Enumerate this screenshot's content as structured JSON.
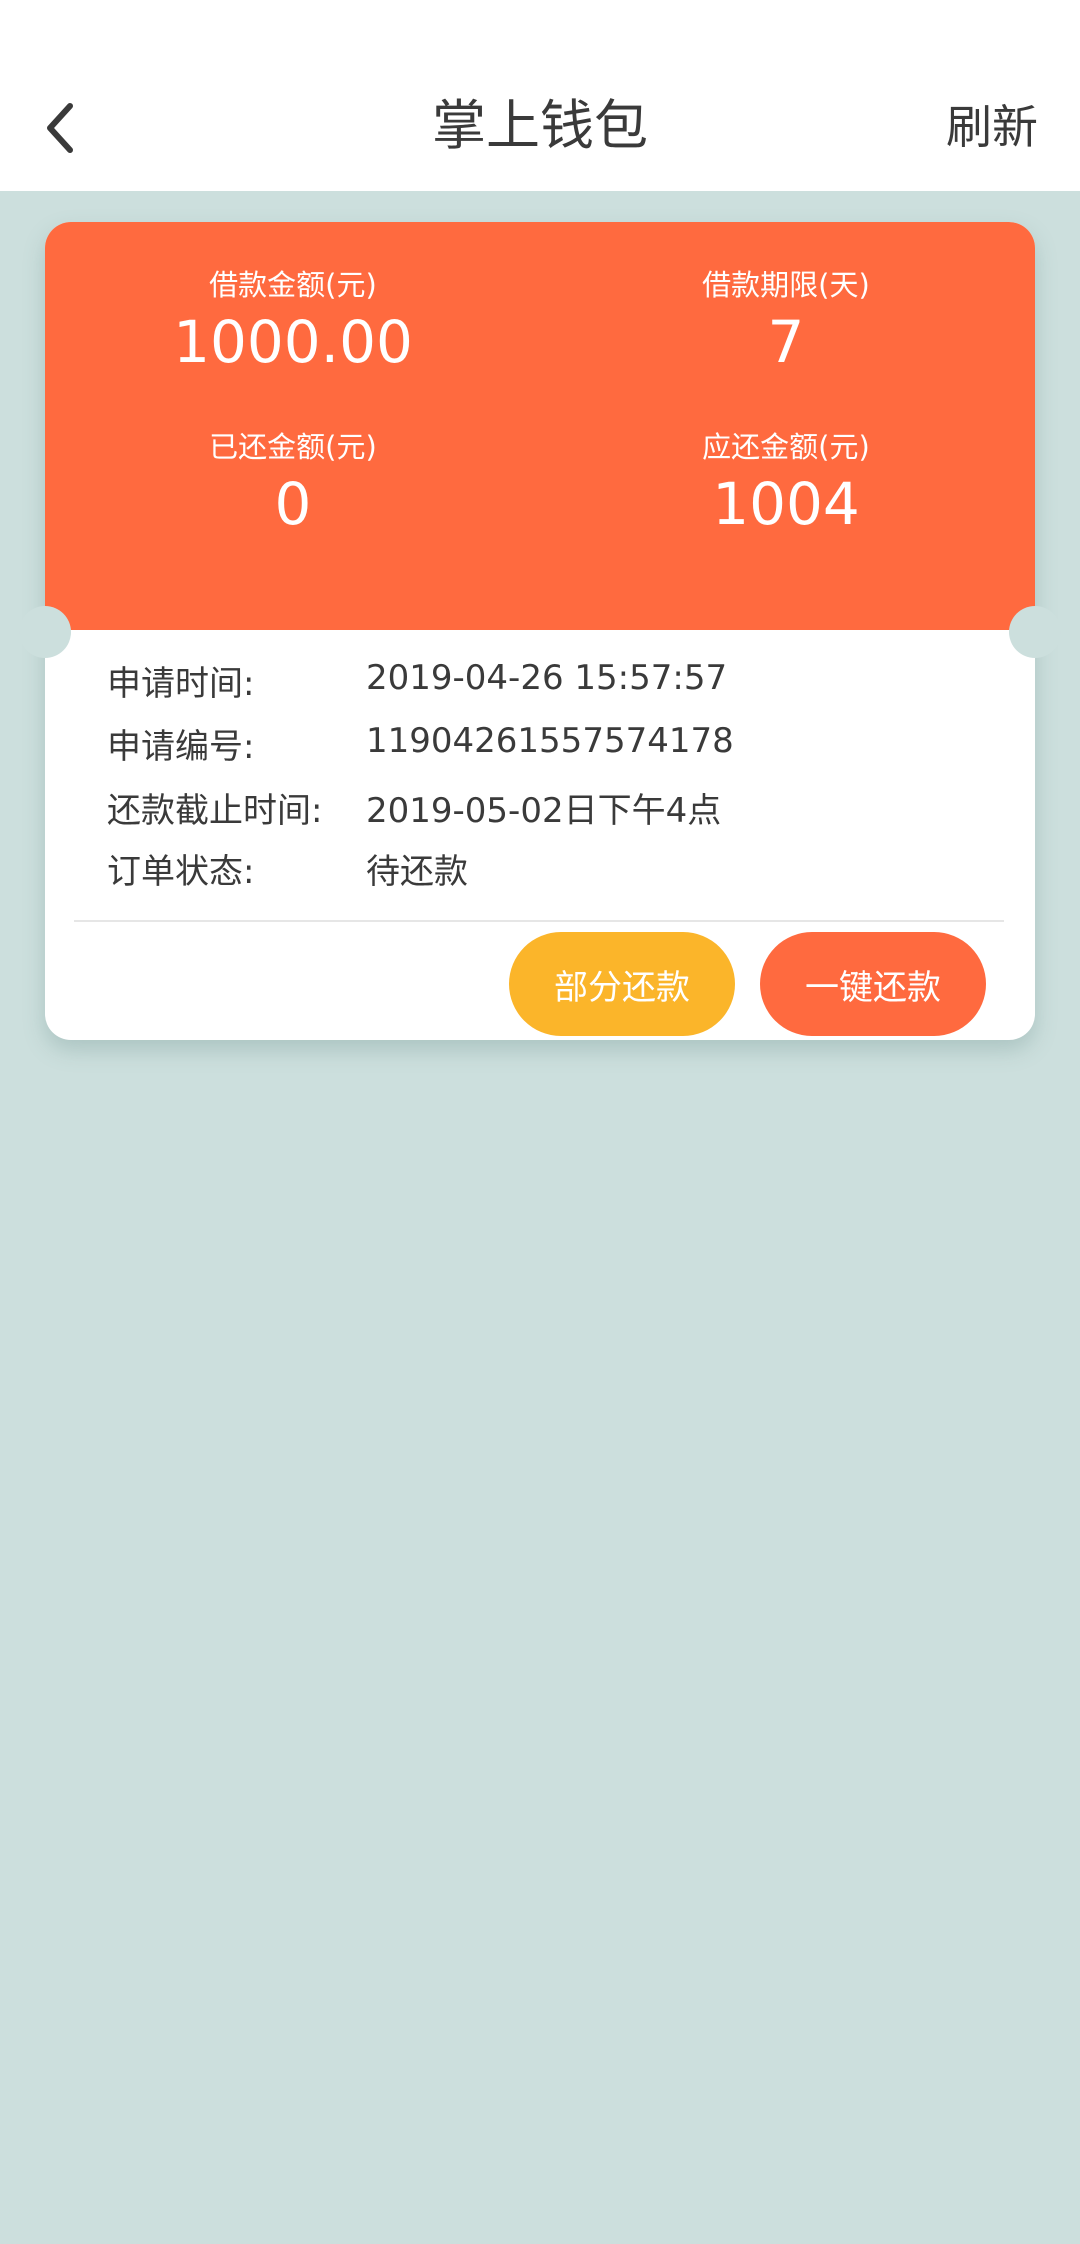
{
  "header": {
    "title": "掌上钱包",
    "refresh_label": "刷新",
    "back_icon": "chevron-left-icon"
  },
  "summary": {
    "loan_amount_label": "借款金额(元)",
    "loan_amount_value": "1000.00",
    "loan_term_label": "借款期限(天)",
    "loan_term_value": "7",
    "repaid_label": "已还金额(元)",
    "repaid_value": "0",
    "due_label": "应还金额(元)",
    "due_value": "1004"
  },
  "details": {
    "apply_time_label": "申请时间:",
    "apply_time_value": "2019-04-26 15:57:57",
    "apply_no_label": "申请编号:",
    "apply_no_value": "11904261557574178",
    "deadline_label": "还款截止时间:",
    "deadline_value": "2019-05-02日下午4点",
    "status_label": "订单状态:",
    "status_value": "待还款"
  },
  "actions": {
    "partial_label": "部分还款",
    "full_label": "一键还款"
  },
  "colors": {
    "accent": "#ff6a3f",
    "secondary": "#fbb52a",
    "background": "#ccdfdd"
  }
}
